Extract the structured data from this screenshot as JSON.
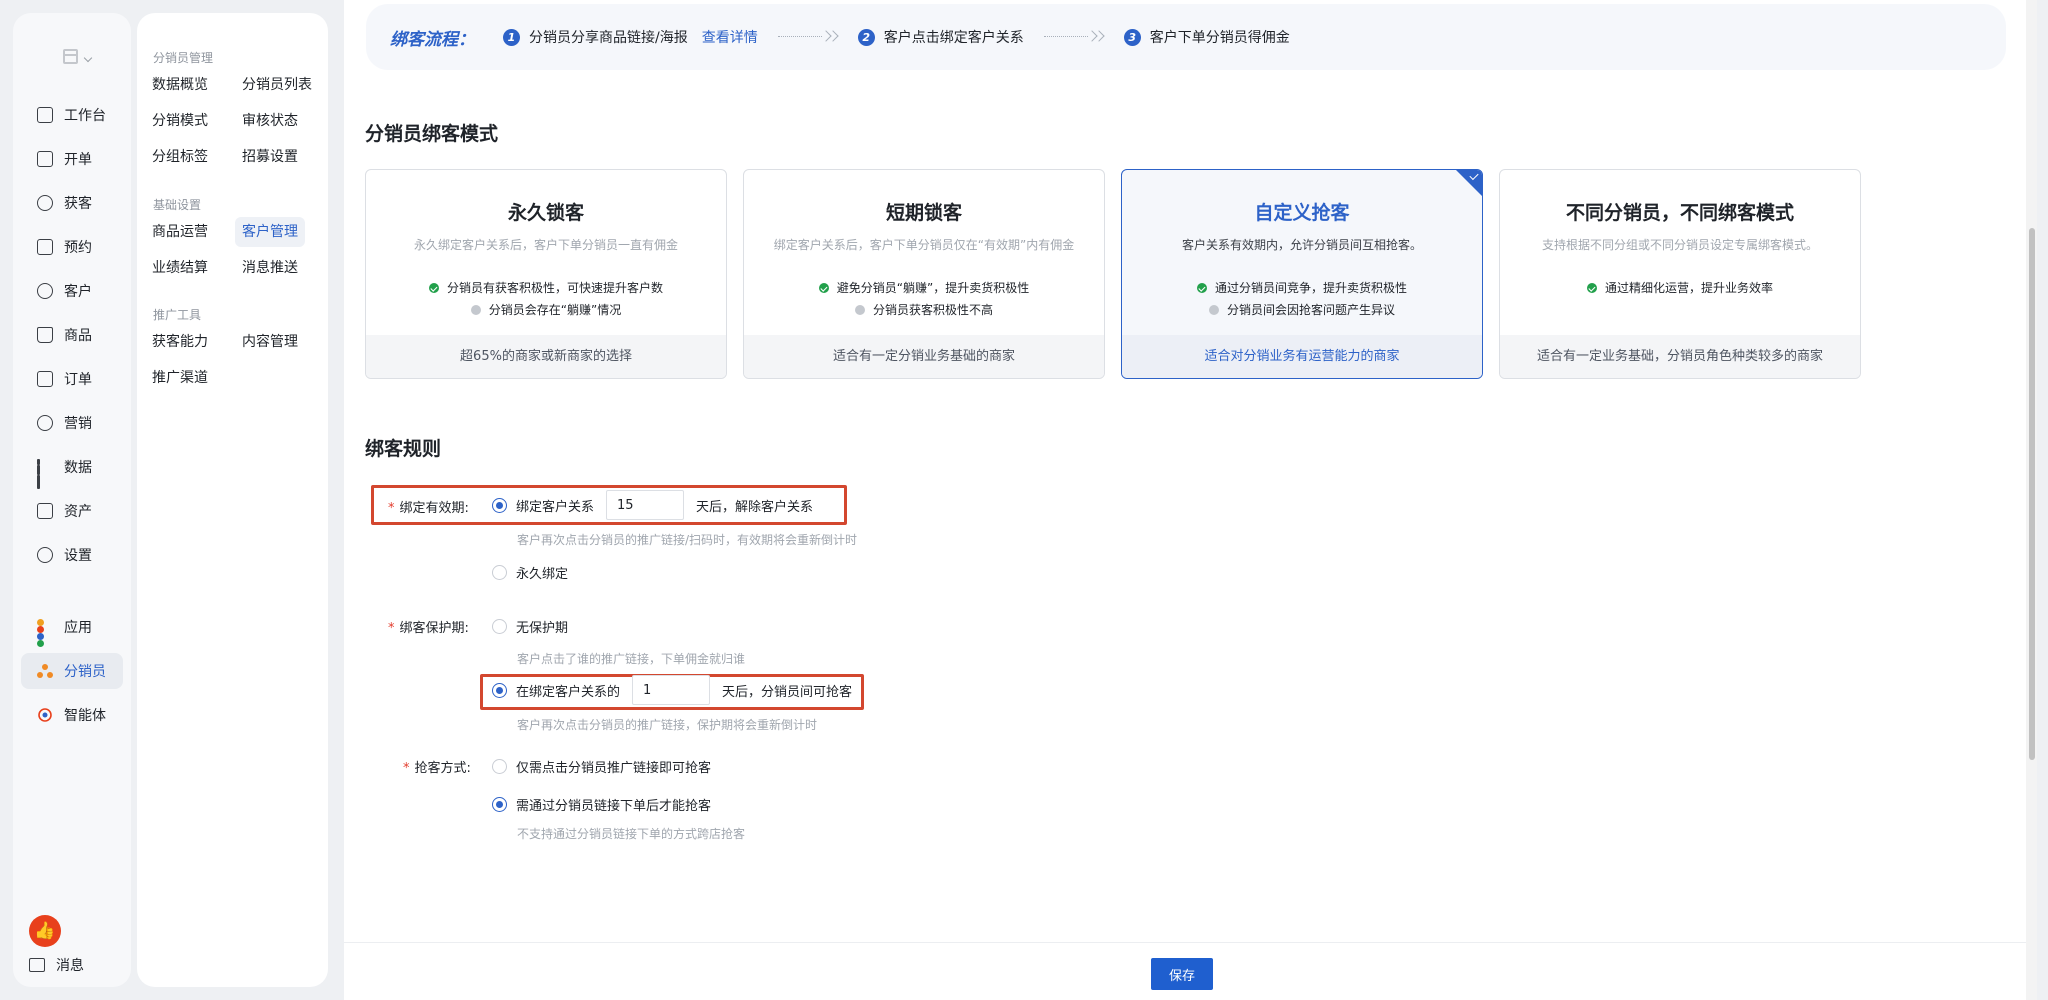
{
  "nav": {
    "items": [
      {
        "label": "工作台"
      },
      {
        "label": "开单"
      },
      {
        "label": "获客"
      },
      {
        "label": "预约"
      },
      {
        "label": "客户"
      },
      {
        "label": "商品"
      },
      {
        "label": "订单"
      },
      {
        "label": "营销"
      },
      {
        "label": "数据"
      },
      {
        "label": "资产"
      },
      {
        "label": "设置"
      }
    ],
    "apps_label": "应用",
    "distributor_label": "分销员",
    "agent_label": "智能体",
    "messages_label": "消息"
  },
  "subnav": {
    "group1_title": "分销员管理",
    "group1": [
      "数据概览",
      "分销员列表",
      "分销模式",
      "审核状态",
      "分组标签",
      "招募设置"
    ],
    "group2_title": "基础设置",
    "group2": [
      "商品运营",
      "客户管理",
      "业绩结算",
      "消息推送"
    ],
    "group3_title": "推广工具",
    "group3": [
      "获客能力",
      "内容管理",
      "推广渠道"
    ]
  },
  "flow": {
    "title": "绑客流程：",
    "steps": [
      {
        "num": "1",
        "text": "分销员分享商品链接/海报"
      },
      {
        "num": "2",
        "text": "客户点击绑定客户关系"
      },
      {
        "num": "3",
        "text": "客户下单分销员得佣金"
      }
    ],
    "detail_link": "查看详情"
  },
  "binding_mode": {
    "title": "分销员绑客模式",
    "cards": [
      {
        "title": "永久锁客",
        "subtitle": "永久绑定客户关系后，客户下单分销员一直有佣金",
        "points": [
          {
            "text": "分销员有获客积极性，可快速提升客户数",
            "type": "good"
          },
          {
            "text": "分销员会存在“躺赚”情况",
            "type": "neutral"
          }
        ],
        "footer": "超65%的商家或新商家的选择"
      },
      {
        "title": "短期锁客",
        "subtitle": "绑定客户关系后，客户下单分销员仅在“有效期”内有佣金",
        "points": [
          {
            "text": "避免分销员“躺赚”，提升卖货积极性",
            "type": "good"
          },
          {
            "text": "分销员获客积极性不高",
            "type": "neutral"
          }
        ],
        "footer": "适合有一定分销业务基础的商家"
      },
      {
        "title": "自定义抢客",
        "subtitle": "客户关系有效期内，允许分销员间互相抢客。",
        "points": [
          {
            "text": "通过分销员间竞争，提升卖货积极性",
            "type": "good"
          },
          {
            "text": "分销员间会因抢客问题产生异议",
            "type": "neutral"
          }
        ],
        "footer": "适合对分销业务有运营能力的商家",
        "selected": true
      },
      {
        "title": "不同分销员，不同绑客模式",
        "subtitle": "支持根据不同分组或不同分销员设定专属绑客模式。",
        "points": [
          {
            "text": "通过精细化运营，提升业务效率",
            "type": "good"
          }
        ],
        "footer": "适合有一定业务基础，分销员角色种类较多的商家"
      }
    ]
  },
  "rules": {
    "title": "绑客规则",
    "validity": {
      "label": "绑定有效期:",
      "option1_prefix": "绑定客户关系",
      "option1_value": "15",
      "option1_suffix": "天后，解除客户关系",
      "option1_hint": "客户再次点击分销员的推广链接/扫码时，有效期将会重新倒计时",
      "option2": "永久绑定"
    },
    "protection": {
      "label": "绑客保护期:",
      "option1": "无保护期",
      "option1_hint": "客户点击了谁的推广链接，下单佣金就归谁",
      "option2_prefix": "在绑定客户关系的",
      "option2_value": "1",
      "option2_suffix": "天后，分销员间可抢客",
      "option2_hint": "客户再次点击分销员的推广链接，保护期将会重新倒计时"
    },
    "grab": {
      "label": "抢客方式:",
      "option1": "仅需点击分销员推广链接即可抢客",
      "option2": "需通过分销员链接下单后才能抢客",
      "option2_hint": "不支持通过分销员链接下单的方式跨店抢客"
    }
  },
  "footer": {
    "save": "保存"
  }
}
